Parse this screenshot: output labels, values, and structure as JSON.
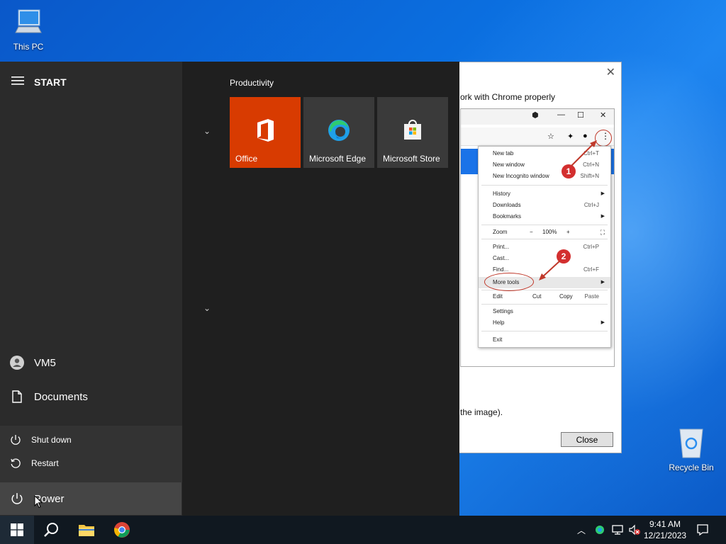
{
  "desktop": {
    "this_pc_label": "This PC",
    "recycle_bin_label": "Recycle Bin"
  },
  "dialog": {
    "intro_text": "ork with Chrome properly",
    "caption_text": "the image).",
    "close_button": "Close",
    "screenshot": {
      "menu_items": [
        {
          "label": "New tab",
          "shortcut": "Ctrl+T"
        },
        {
          "label": "New window",
          "shortcut": "Ctrl+N"
        },
        {
          "label": "New Incognito window",
          "shortcut": "Shift+N"
        },
        {
          "label": "History",
          "shortcut": ""
        },
        {
          "label": "Downloads",
          "shortcut": "Ctrl+J"
        },
        {
          "label": "Bookmarks",
          "shortcut": ""
        },
        {
          "label": "Zoom",
          "shortcut": "100%"
        },
        {
          "label": "Print...",
          "shortcut": "Ctrl+P"
        },
        {
          "label": "Cast...",
          "shortcut": ""
        },
        {
          "label": "Find...",
          "shortcut": "Ctrl+F"
        },
        {
          "label": "More tools",
          "shortcut": ""
        },
        {
          "label": "Edit",
          "shortcut": "Paste"
        },
        {
          "label": "Settings",
          "shortcut": ""
        },
        {
          "label": "Help",
          "shortcut": ""
        },
        {
          "label": "Exit",
          "shortcut": ""
        }
      ],
      "edit_copy": "Copy",
      "edit_cut": "Cut",
      "badge_1": "1",
      "badge_2": "2"
    }
  },
  "start_menu": {
    "title": "START",
    "user_name": "VM5",
    "documents_label": "Documents",
    "shutdown_label": "Shut down",
    "restart_label": "Restart",
    "power_label": "Power",
    "group_title": "Productivity",
    "tiles": [
      {
        "label": "Office",
        "color": "#d83b01"
      },
      {
        "label": "Microsoft Edge",
        "color": "#3a3a3a"
      },
      {
        "label": "Microsoft Store",
        "color": "#3a3a3a"
      }
    ]
  },
  "taskbar": {
    "time": "9:41 AM",
    "date": "12/21/2023"
  }
}
